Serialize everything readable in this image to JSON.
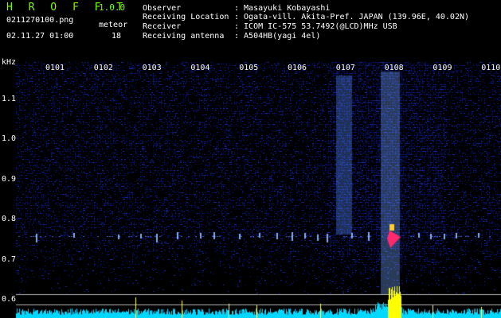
{
  "app": {
    "title": "H R O F F T",
    "version": "1.0.0",
    "filename": "0211270100.png",
    "datetime": "02.11.27 01:00",
    "meteor_label": "meteor",
    "meteor_count": "18"
  },
  "info": {
    "observer": {
      "label": "Observer",
      "value": ": Masayuki Kobayashi"
    },
    "location": {
      "label": "Receiving Location",
      "value": ": Ogata-vill. Akita-Pref. JAPAN (139.96E, 40.02N)"
    },
    "receiver": {
      "label": "Receiver",
      "value": ": ICOM IC-575 53.7492(@LCD)MHz USB"
    },
    "antenna": {
      "label": "Receiving antenna",
      "value": ": A504HB(yagi 4el)"
    }
  },
  "axis": {
    "unit": "kHz",
    "y_labels": [
      "1.1",
      "1.0",
      "0.9",
      "0.8",
      "0.7",
      "0.6"
    ],
    "time_labels": [
      "0101",
      "0102",
      "0103",
      "0104",
      "0105",
      "0106",
      "0107",
      "0108",
      "0109",
      "0110"
    ]
  },
  "colors": {
    "background": "#000000",
    "brand": "#7cfc00",
    "noise": "#1e2cb0",
    "meteor_band": "#3a78ff",
    "meteor_head": "#ff2a6e",
    "level_trace": "#00e5ff",
    "peak": "#ffff00"
  }
}
